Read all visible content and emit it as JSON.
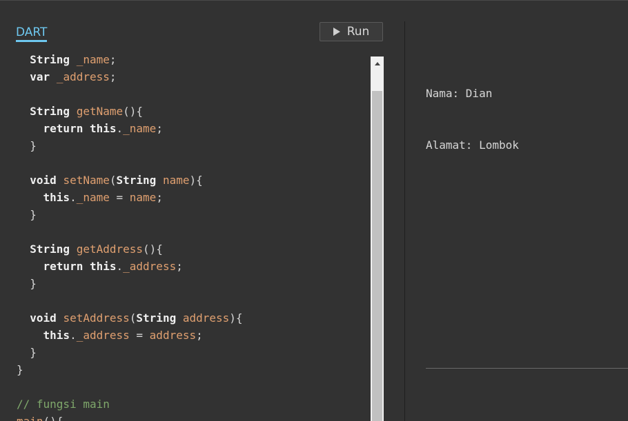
{
  "tabs": {
    "dart_label": "DART"
  },
  "toolbar": {
    "run_label": "Run",
    "run_icon": "play-icon"
  },
  "editor": {
    "lines": [
      [
        {
          "t": "  "
        },
        {
          "c": "kw",
          "t": "String"
        },
        {
          "t": " "
        },
        {
          "c": "id",
          "t": "_name"
        },
        {
          "t": ";"
        }
      ],
      [
        {
          "t": "  "
        },
        {
          "c": "kw",
          "t": "var"
        },
        {
          "t": " "
        },
        {
          "c": "id",
          "t": "_address"
        },
        {
          "t": ";"
        }
      ],
      [
        {
          "t": ""
        }
      ],
      [
        {
          "t": "  "
        },
        {
          "c": "kw",
          "t": "String"
        },
        {
          "t": " "
        },
        {
          "c": "fn",
          "t": "getName"
        },
        {
          "t": "(){"
        }
      ],
      [
        {
          "t": "    "
        },
        {
          "c": "kw",
          "t": "return"
        },
        {
          "t": " "
        },
        {
          "c": "kw",
          "t": "this"
        },
        {
          "t": "."
        },
        {
          "c": "id",
          "t": "_name"
        },
        {
          "t": ";"
        }
      ],
      [
        {
          "t": "  }"
        }
      ],
      [
        {
          "t": ""
        }
      ],
      [
        {
          "t": "  "
        },
        {
          "c": "kw",
          "t": "void"
        },
        {
          "t": " "
        },
        {
          "c": "fn",
          "t": "setName"
        },
        {
          "t": "("
        },
        {
          "c": "kw",
          "t": "String"
        },
        {
          "t": " "
        },
        {
          "c": "id",
          "t": "name"
        },
        {
          "t": "){"
        }
      ],
      [
        {
          "t": "    "
        },
        {
          "c": "kw",
          "t": "this"
        },
        {
          "t": "."
        },
        {
          "c": "id",
          "t": "_name"
        },
        {
          "t": " = "
        },
        {
          "c": "id",
          "t": "name"
        },
        {
          "t": ";"
        }
      ],
      [
        {
          "t": "  }"
        }
      ],
      [
        {
          "t": ""
        }
      ],
      [
        {
          "t": "  "
        },
        {
          "c": "kw",
          "t": "String"
        },
        {
          "t": " "
        },
        {
          "c": "fn",
          "t": "getAddress"
        },
        {
          "t": "(){"
        }
      ],
      [
        {
          "t": "    "
        },
        {
          "c": "kw",
          "t": "return"
        },
        {
          "t": " "
        },
        {
          "c": "kw",
          "t": "this"
        },
        {
          "t": "."
        },
        {
          "c": "id",
          "t": "_address"
        },
        {
          "t": ";"
        }
      ],
      [
        {
          "t": "  }"
        }
      ],
      [
        {
          "t": ""
        }
      ],
      [
        {
          "t": "  "
        },
        {
          "c": "kw",
          "t": "void"
        },
        {
          "t": " "
        },
        {
          "c": "fn",
          "t": "setAddress"
        },
        {
          "t": "("
        },
        {
          "c": "kw",
          "t": "String"
        },
        {
          "t": " "
        },
        {
          "c": "id",
          "t": "address"
        },
        {
          "t": "){"
        }
      ],
      [
        {
          "t": "    "
        },
        {
          "c": "kw",
          "t": "this"
        },
        {
          "t": "."
        },
        {
          "c": "id",
          "t": "_address"
        },
        {
          "t": " = "
        },
        {
          "c": "id",
          "t": "address"
        },
        {
          "t": ";"
        }
      ],
      [
        {
          "t": "  }"
        }
      ],
      [
        {
          "t": "}"
        }
      ],
      [
        {
          "t": ""
        }
      ],
      [
        {
          "c": "cm",
          "t": "// fungsi main"
        }
      ],
      [
        {
          "c": "fn",
          "t": "main"
        },
        {
          "t": "(){"
        }
      ]
    ]
  },
  "output": {
    "line1": "Nama: Dian",
    "line2": "Alamat: Lombok"
  },
  "colors": {
    "accent": "#6ec8f0",
    "background": "#323232",
    "keyword": "#f0f0f0",
    "identifier": "#e0a070",
    "comment": "#7fa86b"
  }
}
